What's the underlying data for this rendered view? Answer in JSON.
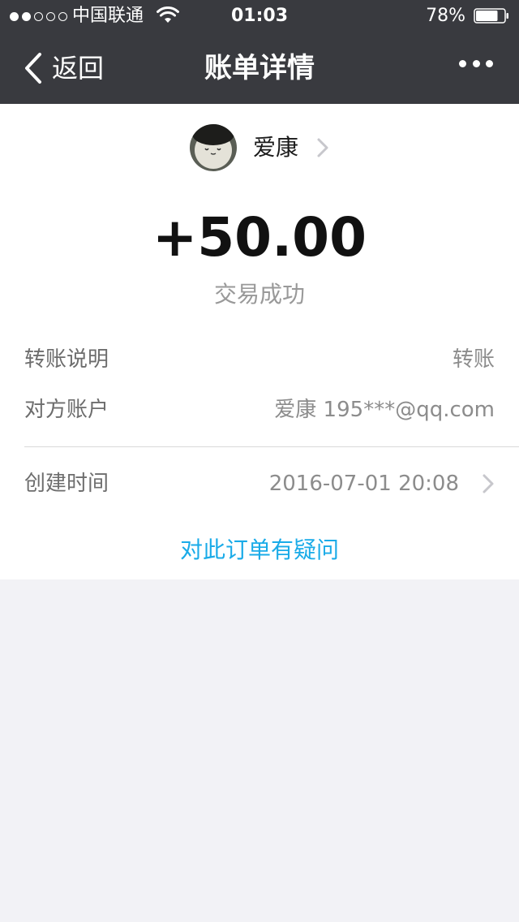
{
  "status_bar": {
    "carrier": "中国联通",
    "time": "01:03",
    "battery_percent": "78%",
    "battery_level": 0.78,
    "signal_bars_filled": 2,
    "signal_bars_total": 5
  },
  "nav": {
    "back_label": "返回",
    "title": "账单详情"
  },
  "payer": {
    "name": "爱康"
  },
  "transaction": {
    "amount": "+50.00",
    "status": "交易成功"
  },
  "details": {
    "description_label": "转账说明",
    "description_value": "转账",
    "account_label": "对方账户",
    "account_value": "爱康 195***@qq.com",
    "time_label": "创建时间",
    "time_value": "2016-07-01 20:08"
  },
  "question_link": "对此订单有疑问",
  "colors": {
    "nav_background": "#393a3f",
    "link": "#1aabe8",
    "page_background": "#f2f2f6"
  },
  "icons": [
    "chevron-left-icon",
    "more-icon",
    "wifi-icon",
    "battery-icon",
    "chevron-right-icon"
  ]
}
